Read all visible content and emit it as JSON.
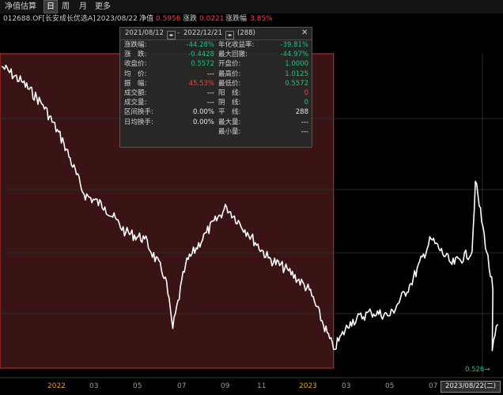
{
  "toolbar": {
    "tabs": [
      {
        "label": "净值估算",
        "active": false
      },
      {
        "label": "日",
        "active": true
      },
      {
        "label": "周",
        "active": false
      },
      {
        "label": "月",
        "active": false
      },
      {
        "label": "更多",
        "active": false
      }
    ]
  },
  "info": {
    "code": "012688.OF[长安成长优选A]",
    "date": "2023/08/22",
    "nav_label": "净值",
    "nav_value": "0.5956",
    "change_label": "涨跌",
    "change_value": "0.0221",
    "pct_label": "涨跌幅",
    "pct_value": "3.85%"
  },
  "panel": {
    "start_date": "2021/08/12",
    "sep": "-",
    "end_date": "2022/12/21",
    "days": "(288)",
    "close": "✕",
    "left": [
      {
        "label": "涨跌幅:",
        "value": "-44.28%",
        "tone": "green"
      },
      {
        "label": "涨　跌:",
        "value": "-0.4428",
        "tone": "green"
      },
      {
        "label": "收盘价:",
        "value": "0.5572",
        "tone": "green"
      },
      {
        "label": "均　价:",
        "value": "---",
        "tone": "white"
      },
      {
        "label": "振　幅:",
        "value": "45.53%",
        "tone": "red"
      },
      {
        "label": "成交额:",
        "value": "---",
        "tone": "white"
      },
      {
        "label": "成交量:",
        "value": "---",
        "tone": "white"
      },
      {
        "label": "区间换手:",
        "value": "0.00%",
        "tone": "white"
      },
      {
        "label": "日均换手:",
        "value": "0.00%",
        "tone": "white"
      }
    ],
    "right": [
      {
        "label": "年化收益率:",
        "value": "-39.81%",
        "tone": "green"
      },
      {
        "label": "最大回撤:",
        "value": "-44.97%",
        "tone": "green"
      },
      {
        "label": "开盘价:",
        "value": "1.0000",
        "tone": "green"
      },
      {
        "label": "最高价:",
        "value": "1.0125",
        "tone": "green"
      },
      {
        "label": "最低价:",
        "value": "0.5572",
        "tone": "green"
      },
      {
        "label": "阳　线:",
        "value": "0",
        "tone": "red"
      },
      {
        "label": "阴　线:",
        "value": "0",
        "tone": "green"
      },
      {
        "label": "平　线:",
        "value": "288",
        "tone": "white"
      },
      {
        "label": "最大量:",
        "value": "---",
        "tone": "white"
      },
      {
        "label": "最小量:",
        "value": "---",
        "tone": "white"
      }
    ]
  },
  "colors": {
    "line": "#ffffff",
    "selection_fill": "#3a1414",
    "selection_border": "#c83232",
    "year_label": "#e0a030",
    "up": "#ff3b3b",
    "down": "#19c37d"
  },
  "chart_data": {
    "type": "line",
    "series": [
      {
        "x": [
          "2021-08",
          "2021-09",
          "2021-10",
          "2021-11",
          "2021-12",
          "2022-01",
          "2022-02",
          "2022-03",
          "2022-04",
          "2022-04-26",
          "2022-05",
          "2022-06",
          "2022-07",
          "2022-08",
          "2022-09",
          "2022-10",
          "2022-11",
          "2022-12-21",
          "2023-01",
          "2023-02",
          "2023-03",
          "2023-04",
          "2023-05",
          "2023-06",
          "2023-07",
          "2023-07-20",
          "2023-08",
          "2023-08-14",
          "2023-08-22"
        ],
        "y": [
          1.0,
          0.975,
          0.94,
          0.88,
          0.8,
          0.78,
          0.74,
          0.73,
          0.67,
          0.59,
          0.69,
          0.74,
          0.78,
          0.74,
          0.7,
          0.68,
          0.65,
          0.5572,
          0.6,
          0.615,
          0.61,
          0.66,
          0.73,
          0.69,
          0.71,
          0.82,
          0.65,
          0.555,
          0.5956
        ]
      }
    ],
    "selection": {
      "from": "2021-08-12",
      "to": "2022-12-21"
    },
    "x_ticks": [
      {
        "label": "2022",
        "year": true
      },
      {
        "label": "03",
        "year": false
      },
      {
        "label": "05",
        "year": false
      },
      {
        "label": "07",
        "year": false
      },
      {
        "label": "09",
        "year": false
      },
      {
        "label": "11",
        "year": false
      },
      {
        "label": "2023",
        "year": true
      },
      {
        "label": "03",
        "year": false
      },
      {
        "label": "05",
        "year": false
      },
      {
        "label": "07",
        "year": false
      }
    ],
    "crosshair_date": "2023/08/22(二)",
    "end_label": "0.526→",
    "grid": true
  }
}
